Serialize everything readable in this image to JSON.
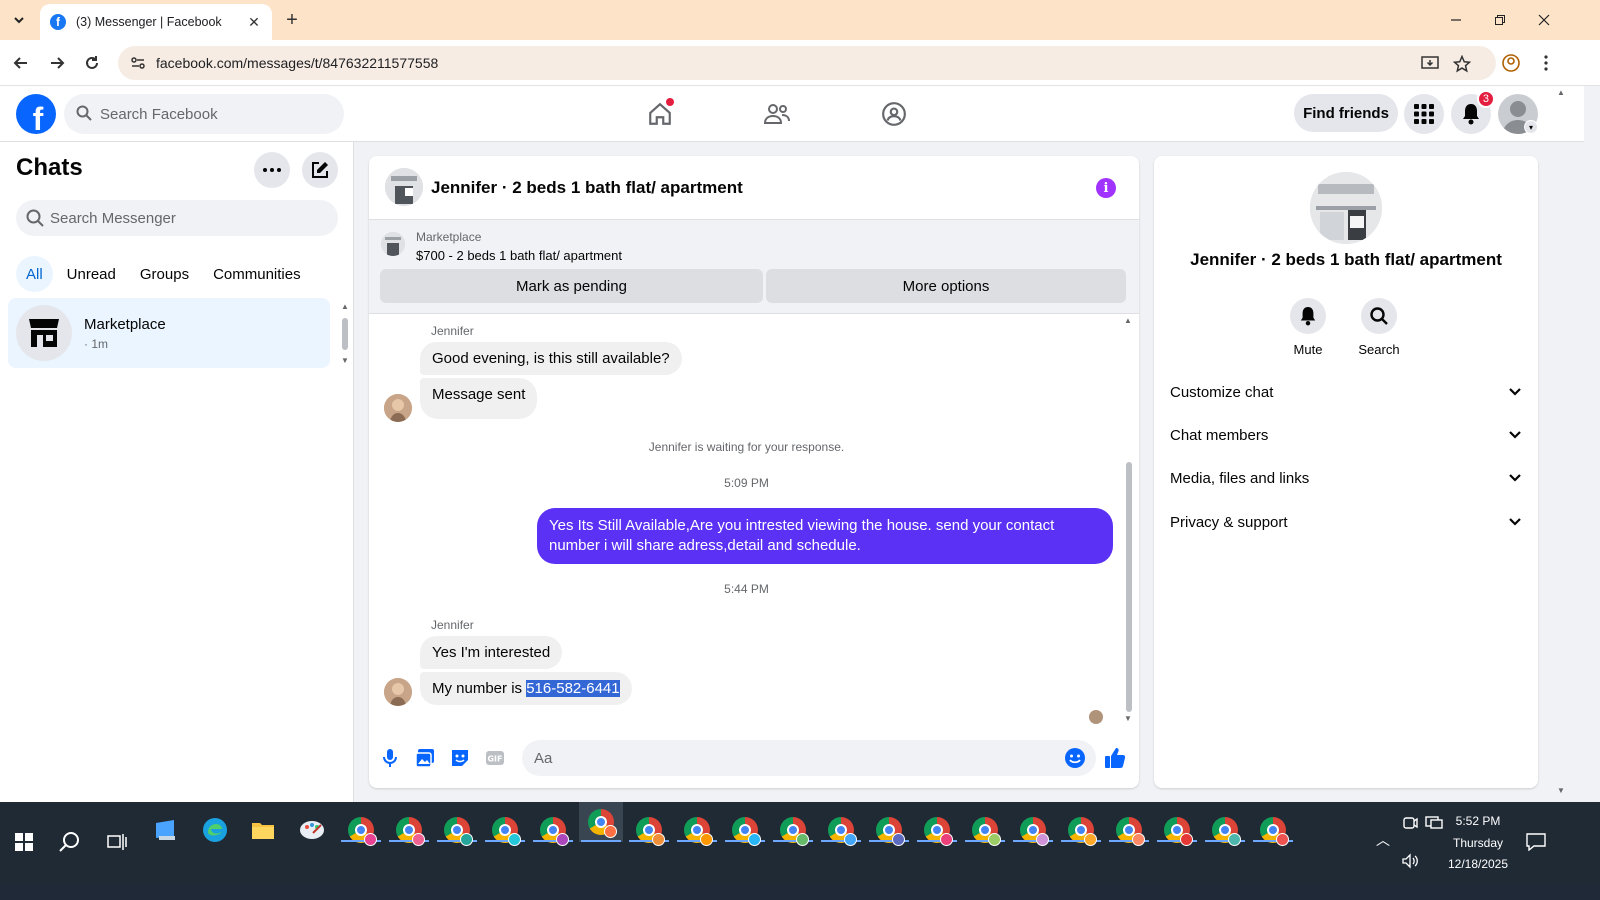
{
  "browser": {
    "tab_title": "(3) Messenger | Facebook",
    "url": "facebook.com/messages/t/847632211577558"
  },
  "fb": {
    "search_placeholder": "Search Facebook",
    "find_friends": "Find friends",
    "notif_count": "3",
    "brand_color": "#0866ff"
  },
  "chats": {
    "title": "Chats",
    "search_placeholder": "Search Messenger",
    "filters": [
      "All",
      "Unread",
      "Groups",
      "Communities"
    ],
    "active_filter": "All",
    "items": [
      {
        "name": "Marketplace",
        "time": "· 1m"
      }
    ]
  },
  "conversation": {
    "title": "Jennifer · 2 beds 1 bath flat/ apartment",
    "marketplace_label": "Marketplace",
    "listing": "$700 - 2 beds 1 bath flat/ apartment",
    "mark_pending": "Mark as pending",
    "more_options": "More options",
    "sender": "Jennifer",
    "messages_1": [
      "Good evening, is this still available?",
      "Message sent"
    ],
    "system_note": "Jennifer is waiting for your response.",
    "time_1": "5:09 PM",
    "outgoing": "Yes Its Still Available,Are you intrested viewing the house. send your contact number i will share adress,detail and schedule.",
    "time_2": "5:44 PM",
    "messages_2_first": "Yes I'm interested",
    "number_prefix": "My number is ",
    "number": "516-582-6441",
    "composer_placeholder": "Aa",
    "accent_color": "#5b32f5"
  },
  "info": {
    "name": "Jennifer · 2 beds 1 bath flat/ apartment",
    "actions": [
      "Mute",
      "Search"
    ],
    "rows": [
      "Customize chat",
      "Chat members",
      "Media, files and links",
      "Privacy & support"
    ]
  },
  "taskbar": {
    "time": "5:52 PM",
    "day": "Thursday",
    "date": "12/18/2025"
  }
}
